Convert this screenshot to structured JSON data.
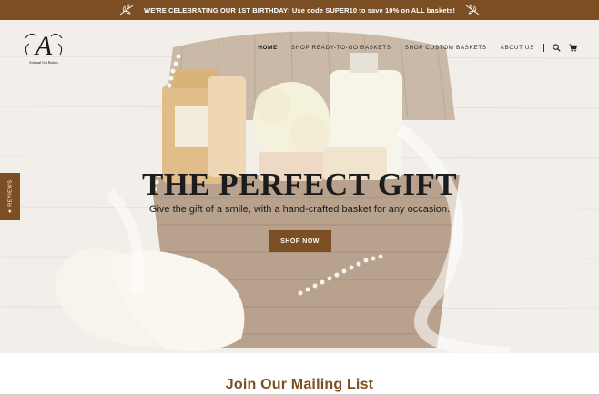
{
  "announcement": {
    "text": "WE'RE CELEBRATING OUR 1ST BIRTHDAY! Use code SUPER10 to save 10% on ALL baskets!"
  },
  "brand": {
    "logo_letter": "A",
    "logo_name": "Artisanal Gift Baskets"
  },
  "nav": {
    "items": [
      {
        "label": "HOME",
        "active": true
      },
      {
        "label": "SHOP READY-TO-GO BASKETS",
        "active": false
      },
      {
        "label": "SHOP CUSTOM BASKETS",
        "active": false
      },
      {
        "label": "ABOUT US",
        "active": false
      }
    ],
    "icons": [
      "search-icon",
      "cart-icon"
    ]
  },
  "hero": {
    "title": "THE PERFECT GIFT",
    "subtitle": "Give the gift of a smile, with a hand-crafted basket for any occasion.",
    "button_label": "SHOP NOW"
  },
  "reviews_tab": {
    "label": "★ REVIEWS"
  },
  "mailing": {
    "heading": "Join Our Mailing List"
  },
  "colors": {
    "brand_brown": "#7b4f23",
    "text_dark": "#1c1c1c",
    "wood_light": "#eeeae4"
  }
}
